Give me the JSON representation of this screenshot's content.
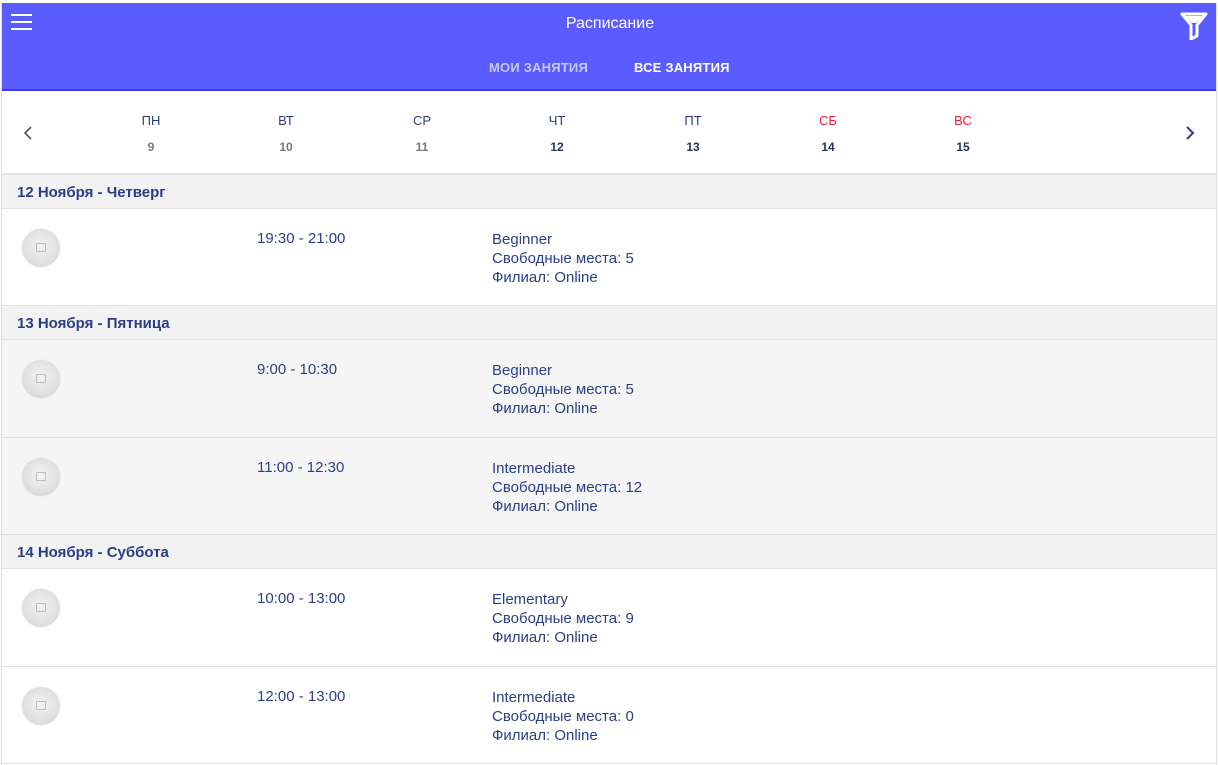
{
  "header": {
    "title": "Расписание",
    "tabs": [
      "МОИ ЗАНЯТИЯ",
      "ВСЕ ЗАНЯТИЯ"
    ],
    "active_tab": "ВСЕ ЗАНЯТИЯ",
    "accent_color": "#5a5cff"
  },
  "week": {
    "days": [
      {
        "name": "ПН",
        "date": "9"
      },
      {
        "name": "ВТ",
        "date": "10"
      },
      {
        "name": "СР",
        "date": "11"
      },
      {
        "name": "ЧТ",
        "date": "12"
      },
      {
        "name": "ПТ",
        "date": "13"
      },
      {
        "name": "СБ",
        "date": "14"
      },
      {
        "name": "ВС",
        "date": "15"
      }
    ]
  },
  "schedule": [
    {
      "date_label": "12 Ноября - Четверг",
      "lessons": [
        {
          "time": "19:30 - 21:00",
          "level": "Beginner",
          "seats": "Свободные места: 5",
          "branch": "Филиал: Online"
        }
      ]
    },
    {
      "date_label": "13 Ноября - Пятница",
      "lessons": [
        {
          "time": "9:00 - 10:30",
          "level": "Beginner",
          "seats": "Свободные места: 5",
          "branch": "Филиал: Online"
        },
        {
          "time": "11:00 - 12:30",
          "level": "Intermediate",
          "seats": "Свободные места: 12",
          "branch": "Филиал: Online"
        }
      ]
    },
    {
      "date_label": "14 Ноября - Суббота",
      "lessons": [
        {
          "time": "10:00 - 13:00",
          "level": "Elementary",
          "seats": "Свободные места: 9",
          "branch": "Филиал: Online"
        },
        {
          "time": "12:00 - 13:00",
          "level": "Intermediate",
          "seats": "Свободные места: 0",
          "branch": "Филиал: Online"
        }
      ]
    }
  ]
}
